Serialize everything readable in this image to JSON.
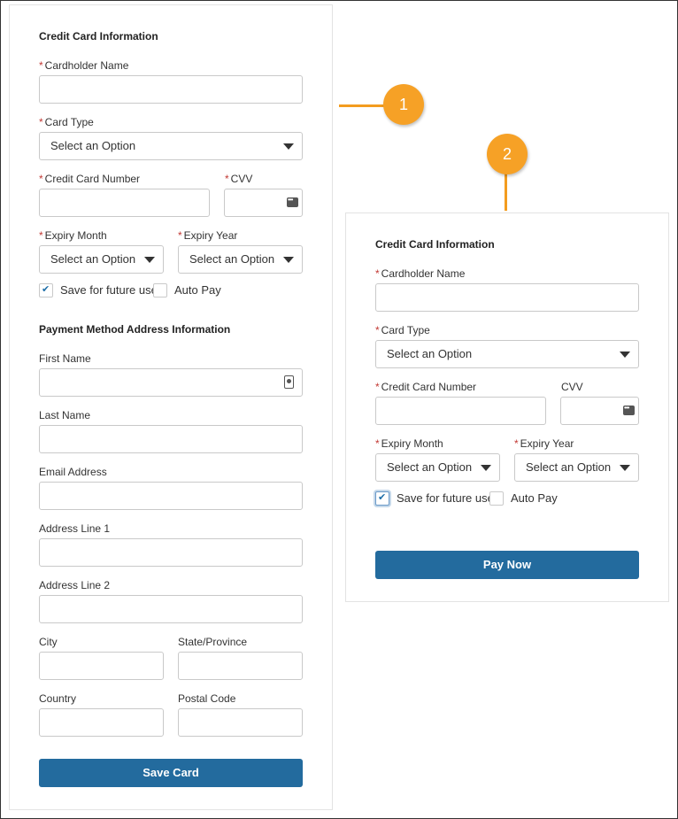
{
  "form1": {
    "section_title": "Credit Card Information",
    "cardholder_label": "Cardholder Name",
    "card_type_label": "Card Type",
    "card_type_value": "Select an Option",
    "cc_number_label": "Credit Card Number",
    "cvv_label": "CVV",
    "expiry_month_label": "Expiry Month",
    "expiry_month_value": "Select an Option",
    "expiry_year_label": "Expiry Year",
    "expiry_year_value": "Select an Option",
    "save_future_label": "Save for future use",
    "auto_pay_label": "Auto Pay",
    "address_section_title": "Payment Method Address Information",
    "first_name_label": "First Name",
    "last_name_label": "Last Name",
    "email_label": "Email Address",
    "address1_label": "Address Line 1",
    "address2_label": "Address Line 2",
    "city_label": "City",
    "state_label": "State/Province",
    "country_label": "Country",
    "postal_label": "Postal Code",
    "save_button": "Save Card"
  },
  "form2": {
    "section_title": "Credit Card Information",
    "cardholder_label": "Cardholder Name",
    "card_type_label": "Card Type",
    "card_type_value": "Select an Option",
    "cc_number_label": "Credit Card Number",
    "cvv_label": "CVV",
    "expiry_month_label": "Expiry Month",
    "expiry_month_value": "Select an Option",
    "expiry_year_label": "Expiry Year",
    "expiry_year_value": "Select an Option",
    "save_future_label": "Save for future use",
    "auto_pay_label": "Auto Pay",
    "pay_button": "Pay Now"
  },
  "callouts": {
    "one": "1",
    "two": "2"
  },
  "required_marker": "*",
  "colors": {
    "button": "#236b9e",
    "callout": "#f6a126",
    "required": "#c23934"
  }
}
